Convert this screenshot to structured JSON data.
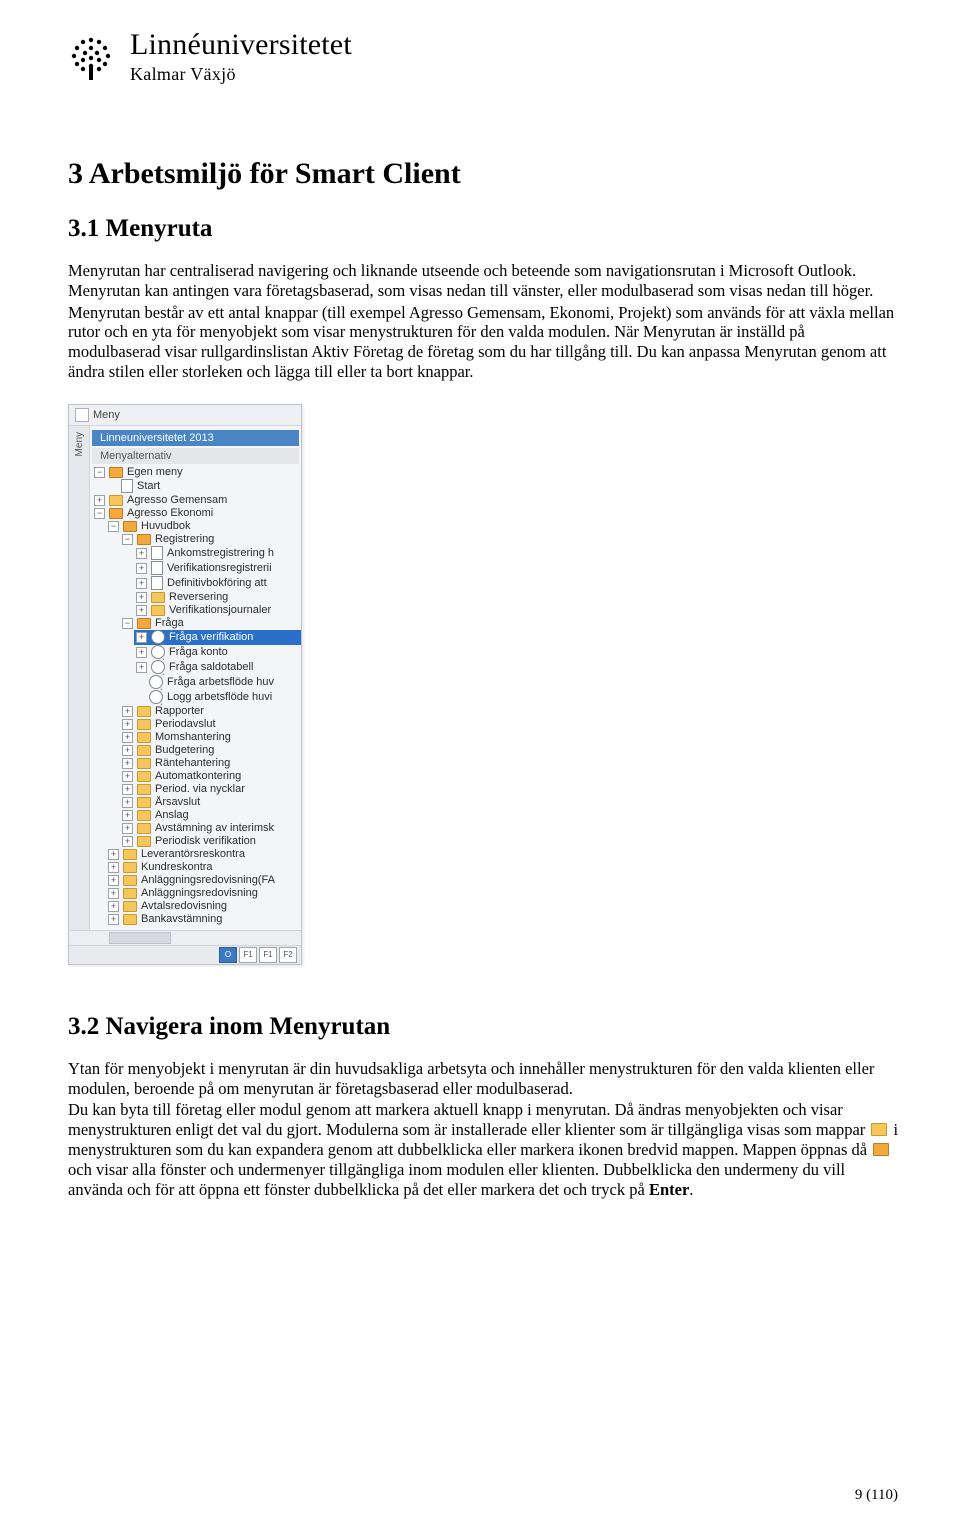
{
  "logo": {
    "line1": "Linnéuniversitetet",
    "line2": "Kalmar Växjö"
  },
  "h1": "3 Arbetsmiljö för Smart Client",
  "h2a": "3.1 Menyruta",
  "para1": "Menyrutan har centraliserad navigering och liknande utseende och beteende som navigationsrutan i Microsoft Outlook. Menyrutan kan antingen vara företagsbaserad, som visas nedan till vänster, eller modulbaserad som visas nedan till höger.",
  "para2": "Menyrutan består av ett antal knappar (till exempel Agresso Gemensam, Ekonomi, Projekt) som används för att växla mellan rutor och en yta för menyobjekt som visar menystrukturen för den valda modulen. När Menyrutan är inställd på modulbaserad visar rullgardinslistan Aktiv Företag de företag som du har tillgång till. Du kan anpassa Menyrutan genom att ändra stilen eller storleken och lägga till eller ta bort knappar.",
  "shot": {
    "head_title": "Meny",
    "vtab": "Meny",
    "banner": "Linneuniversitetet 2013",
    "subhead": "Menyalternativ",
    "tree": {
      "egen": "Egen meny",
      "start": "Start",
      "agr_gem": "Agresso Gemensam",
      "agr_eko": "Agresso Ekonomi",
      "huvudbok": "Huvudbok",
      "registrering": "Registrering",
      "ankomst": "Ankomstregistrering h",
      "verifreg": "Verifikationsregistrerii",
      "defbok": "Definitivbokföring att",
      "reversering": "Reversering",
      "verifjourn": "Verifikationsjournaler",
      "fraga": "Fråga",
      "fraga_ver": "Fråga verifikation",
      "fraga_konto": "Fråga konto",
      "fraga_saldo": "Fråga saldotabell",
      "fraga_arb": "Fråga arbetsflöde huv",
      "logg_arb": "Logg arbetsflöde huvi",
      "rapporter": "Rapporter",
      "periodavslut": "Periodavslut",
      "momshantering": "Momshantering",
      "budgetering": "Budgetering",
      "rantehantering": "Räntehantering",
      "automatkontering": "Automatkontering",
      "period_via": "Period. via nycklar",
      "arsavslut": "Årsavslut",
      "anslag": "Anslag",
      "avstamning": "Avstämning av interimsk",
      "periodisk_ver": "Periodisk verifikation",
      "lev": "Leverantörsreskontra",
      "kund": "Kundreskontra",
      "anlfa": "Anläggningsredovisning(FA",
      "anl": "Anläggningsredovisning",
      "avtal": "Avtalsredovisning",
      "bank": "Bankavstämning"
    },
    "foot": {
      "b1": "O",
      "b2": "F1",
      "b3": "F1",
      "b4": "F2"
    }
  },
  "h2b": "3.2 Navigera inom Menyrutan",
  "para3_a": "Ytan för menyobjekt i menyrutan är din huvudsakliga arbetsyta och innehåller menystrukturen för den valda klienten eller modulen, beroende på om menyrutan är företagsbaserad eller modulbaserad.",
  "para3_b": "Du kan byta till företag eller modul genom att markera aktuell knapp i menyrutan. Då ändras menyobjekten och visar menystrukturen enligt det val du gjort. Modulerna som är installerade eller klienter som är tillgängliga visas som mappar ",
  "para3_c": " i menystrukturen som du kan expandera genom att dubbelklicka eller markera ikonen bredvid mappen. Mappen öppnas då ",
  "para3_d": " och visar alla fönster och undermenyer tillgängliga inom modulen eller klienten. Dubbelklicka den undermeny du vill använda och för att öppna ett fönster dubbelklicka på det eller markera det och tryck på ",
  "enter_word": "Enter",
  "para3_e": ".",
  "pagenum": "9 (110)"
}
